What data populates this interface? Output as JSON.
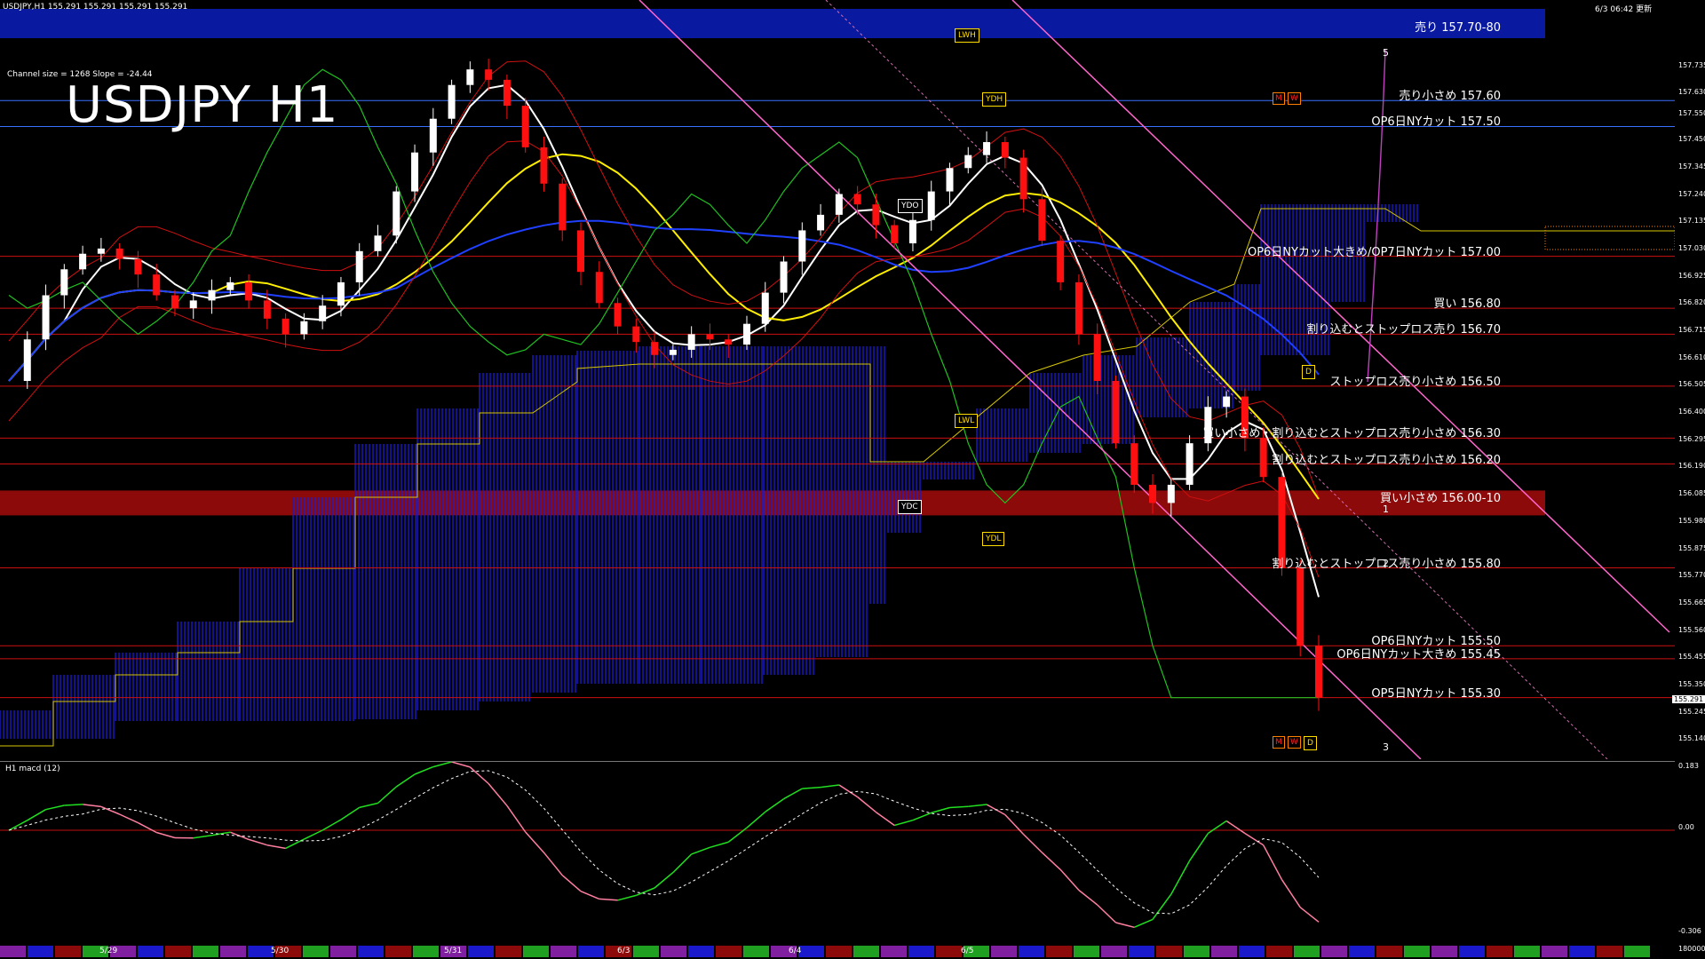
{
  "header": {
    "symbol_info": "USDJPY,H1  155.291 155.291 155.291 155.291",
    "datetime": "6/3 06:42 更新",
    "channel_info": "Channel size = 1268 Slope = -24.44",
    "title": "USDJPY H1"
  },
  "colors": {
    "background": "#000000",
    "candle_up": "#ffffff",
    "candle_down": "#ff1010",
    "cloud": "#1a1acc",
    "sell_band": "#0a1aa0",
    "buy_band": "#8c0a0a",
    "channel": "#ff66cc",
    "ma_white": "#ffffff",
    "ma_yellow": "#ffee00",
    "ma_blue": "#2040ff",
    "chikou": "#20c020",
    "bollinger": "#d01010",
    "macd_up": "#20e020",
    "macd_down": "#ff7fa0"
  },
  "levels": [
    {
      "label": "売り 157.70-80",
      "price": 157.75,
      "kind": "band-sell"
    },
    {
      "label": "売り小さめ 157.60",
      "price": 157.6,
      "kind": "line"
    },
    {
      "label": "OP6日NYカット 157.50",
      "price": 157.5,
      "kind": "line"
    },
    {
      "label": "OP6日NYカット大きめ/OP7日NYカット 157.00",
      "price": 157.0,
      "kind": "line"
    },
    {
      "label": "買い 156.80",
      "price": 156.8,
      "kind": "line"
    },
    {
      "label": "割り込むとストップロス売り 156.70",
      "price": 156.7,
      "kind": "line"
    },
    {
      "label": "ストップロス売り小さめ 156.50",
      "price": 156.5,
      "kind": "line"
    },
    {
      "label": "買い小さめ・割り込むとストップロス売り小さめ 156.30",
      "price": 156.3,
      "kind": "line"
    },
    {
      "label": "割り込むとストップロス売り小さめ 156.20",
      "price": 156.2,
      "kind": "line"
    },
    {
      "label": "買い小さめ 156.00-10",
      "price": 156.05,
      "kind": "band-buy"
    },
    {
      "label": "割り込むとストップロス売り小さめ 155.80",
      "price": 155.8,
      "kind": "line"
    },
    {
      "label": "OP6日NYカット 155.50",
      "price": 155.5,
      "kind": "line"
    },
    {
      "label": "OP6日NYカット大きめ 155.45",
      "price": 155.45,
      "kind": "line"
    },
    {
      "label": "OP5日NYカット 155.30",
      "price": 155.3,
      "kind": "line"
    }
  ],
  "tags": {
    "lwh": "LWH",
    "ydh": "YDH",
    "ydo": "YDO",
    "lwl": "LWL",
    "ydc": "YDC",
    "ydl": "YDL",
    "d": "D",
    "m": "M",
    "w": "W"
  },
  "channel_numbers": [
    "5",
    "1",
    "2",
    "3"
  ],
  "current_price": "155.291",
  "macd": {
    "title": "H1  macd (12)",
    "axis": [
      "0.183",
      "0.00",
      "-0.306",
      "180000"
    ]
  },
  "chart_data": {
    "type": "line",
    "ylim": [
      155.08,
      157.96
    ],
    "y_ticks": [
      "157.735",
      "157.630",
      "157.550",
      "157.450",
      "157.345",
      "157.240",
      "157.135",
      "157.030",
      "156.925",
      "156.820",
      "156.715",
      "156.610",
      "156.505",
      "156.400",
      "156.295",
      "156.190",
      "156.085",
      "155.980",
      "155.875",
      "155.770",
      "155.665",
      "155.560",
      "155.455",
      "155.350",
      "155.245",
      "155.140"
    ],
    "x_labels": [
      "5/29",
      "5/30",
      "5/31",
      "6/3",
      "6/4",
      "6/5"
    ],
    "series": [
      {
        "values": [
          156.52,
          156.68,
          156.85,
          156.95,
          157.01,
          157.03,
          156.99,
          156.93,
          156.85,
          156.8,
          156.83,
          156.87,
          156.9,
          156.83,
          156.76,
          156.7,
          156.75,
          156.81,
          156.9,
          157.02,
          157.08,
          157.25,
          157.4,
          157.53,
          157.66,
          157.72,
          157.68,
          157.58,
          157.42,
          157.28,
          157.1,
          156.94,
          156.82,
          156.73,
          156.67,
          156.62,
          156.64,
          156.7,
          156.68,
          156.66,
          156.74,
          156.86,
          156.98,
          157.1,
          157.16,
          157.24,
          157.2,
          157.12,
          157.05,
          157.14,
          157.25,
          157.34,
          157.39,
          157.44,
          157.38,
          157.22,
          157.06,
          156.9,
          156.7,
          156.52,
          156.28,
          156.12,
          156.05,
          156.12,
          156.28,
          156.42,
          156.46,
          156.3,
          156.15,
          155.8,
          155.5,
          155.3
        ]
      }
    ]
  }
}
